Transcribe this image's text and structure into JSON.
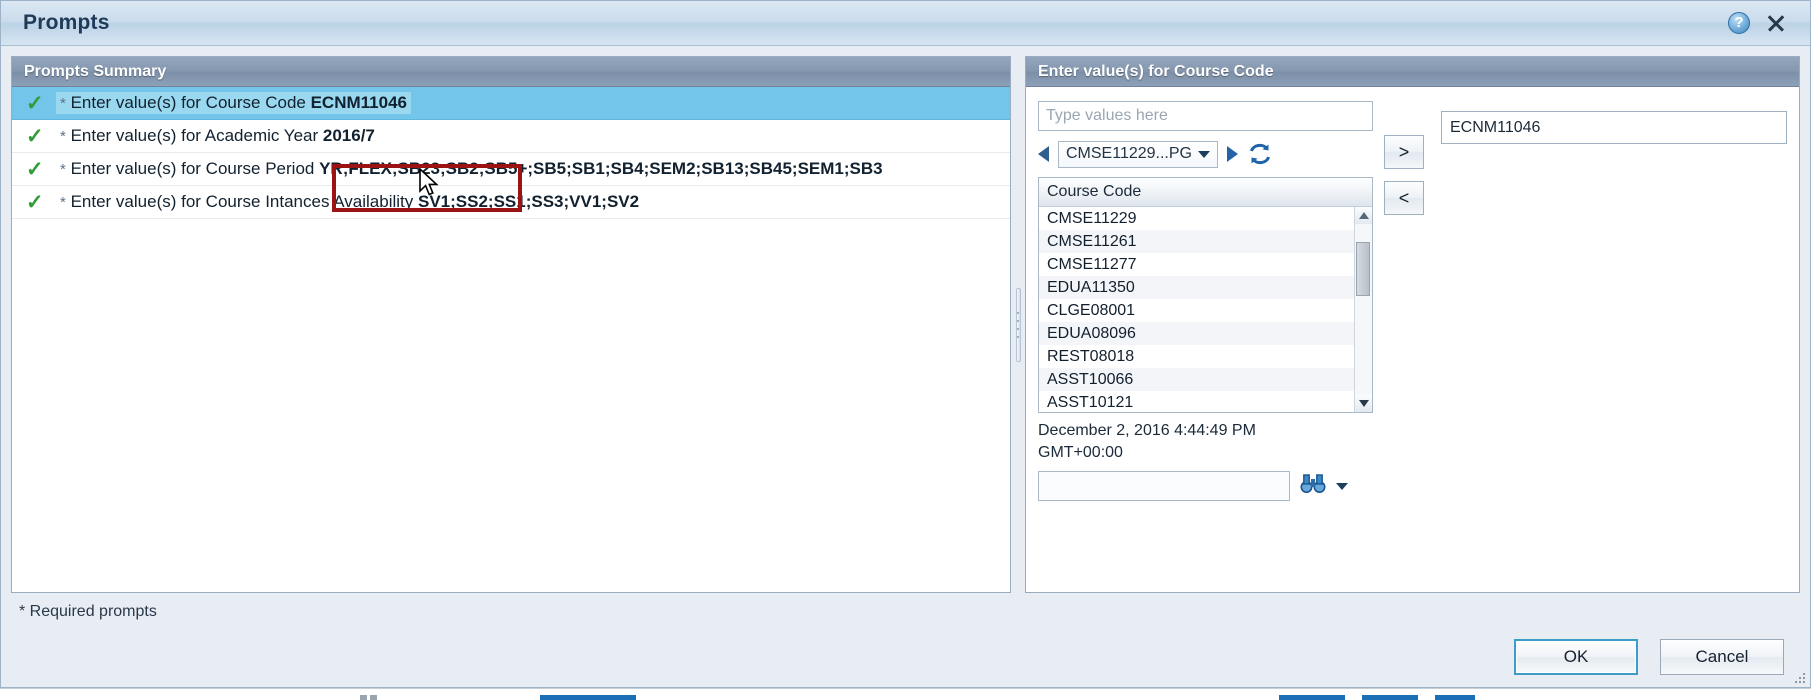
{
  "window": {
    "title": "Prompts",
    "help_icon": "help-icon",
    "close_icon": "close-icon"
  },
  "left_panel": {
    "header": "Prompts Summary",
    "rows": [
      {
        "check": "✓",
        "star": "*",
        "label": "Enter value(s) for Course Code",
        "value": "ECNM11046",
        "selected": true
      },
      {
        "check": "✓",
        "star": "*",
        "label": "Enter value(s) for Academic Year",
        "value": "2016/7",
        "selected": false
      },
      {
        "check": "✓",
        "star": "*",
        "label": "Enter value(s) for Course Period",
        "value": "YR;FLEX;SB23;SB2;SB5+;SB5;SB1;SB4;SEM2;SB13;SB45;SEM1;SB3",
        "selected": false
      },
      {
        "check": "✓",
        "star": "*",
        "label": "Enter value(s) for Course Intances Availability",
        "value": "SV1;SS2;SS1;SS3;VV1;SV2",
        "selected": false
      }
    ]
  },
  "right_panel": {
    "header": "Enter value(s) for Course Code",
    "type_values_placeholder": "Type values here",
    "type_values_value": "",
    "nav": {
      "prev_icon": "triangle-left-icon",
      "next_icon": "triangle-right-icon",
      "refresh_icon": "refresh-icon",
      "combo_value": "CMSE11229...PG",
      "combo_caret": "chevron-down-icon"
    },
    "listbox": {
      "column_header": "Course Code",
      "items": [
        "CMSE11229",
        "CMSE11261",
        "CMSE11277",
        "EDUA11350",
        "CLGE08001",
        "EDUA08096",
        "REST08018",
        "ASST10066",
        "ASST10121"
      ],
      "scroll_up_icon": "scroll-up-icon",
      "scroll_down_icon": "scroll-down-icon"
    },
    "timestamp_line1": "December 2, 2016 4:44:49 PM",
    "timestamp_line2": "GMT+00:00",
    "search": {
      "value": "",
      "placeholder": "",
      "binoculars_icon": "binoculars-icon",
      "dropdown_icon": "chevron-down-icon"
    },
    "add_button": ">",
    "remove_button": "<",
    "selected_values": [
      "ECNM11046"
    ]
  },
  "footer": {
    "required_note": "* Required prompts",
    "ok_label": "OK",
    "cancel_label": "Cancel"
  },
  "colors": {
    "selection_blue": "#73c5ea",
    "highlight_red": "#9c1313",
    "check_green": "#2f9c35",
    "header_slate": "#8497af"
  }
}
